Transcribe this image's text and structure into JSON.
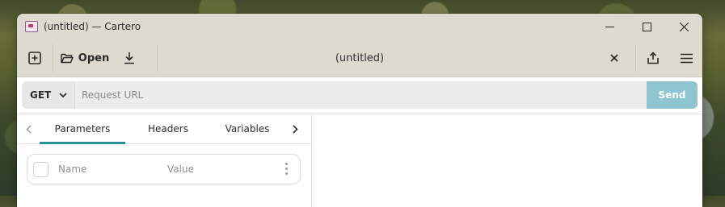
{
  "window": {
    "title": "(untitled) — Cartero"
  },
  "headerbar": {
    "new_label": "",
    "open_label": "Open",
    "tab_title": "(untitled)"
  },
  "request": {
    "method": "GET",
    "url_value": "",
    "url_placeholder": "Request URL",
    "send_label": "Send"
  },
  "tabs": [
    {
      "label": "Parameters",
      "active": true
    },
    {
      "label": "Headers",
      "active": false
    },
    {
      "label": "Variables",
      "active": false
    }
  ],
  "param_row": {
    "name_placeholder": "Name",
    "value_placeholder": "Value"
  },
  "colors": {
    "accent": "#2a8f9c",
    "send_disabled": "#8ec5d0",
    "titlebar": "#dedad0"
  },
  "icons": [
    "app-icon",
    "minimize-icon",
    "maximize-icon",
    "close-icon",
    "new-tab-icon",
    "folder-open-icon",
    "download-icon",
    "close-tab-icon",
    "share-icon",
    "hamburger-menu-icon",
    "chevron-down-icon",
    "chevron-left-icon",
    "chevron-right-icon",
    "kebab-menu-icon"
  ]
}
